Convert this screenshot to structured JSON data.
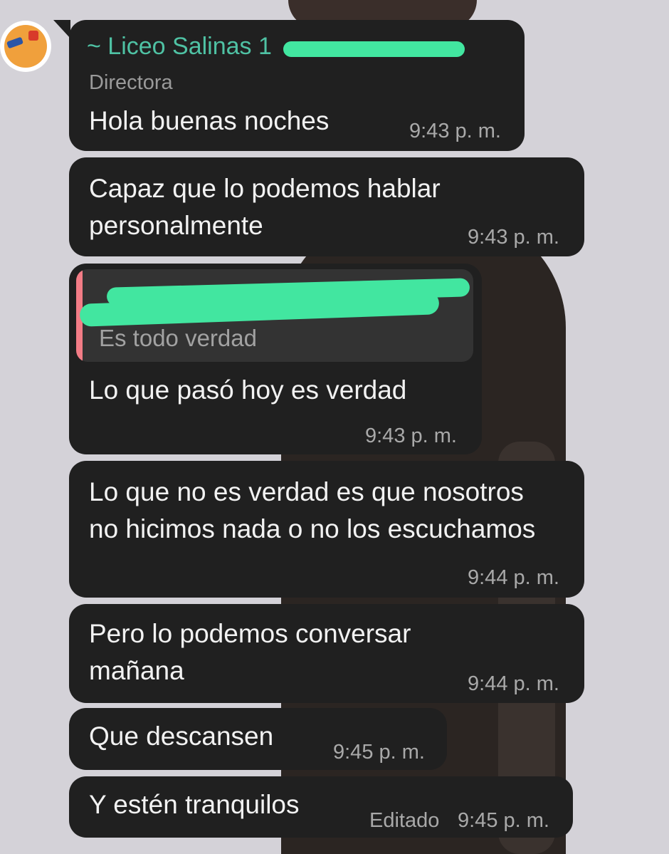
{
  "chat": {
    "group_sender": "~ Liceo Salinas 1",
    "sender_role": "Directora",
    "messages": [
      {
        "text": "Hola buenas noches",
        "time": "9:43 p. m."
      },
      {
        "text": "Capaz que lo podemos hablar personalmente",
        "time": "9:43 p. m."
      },
      {
        "quoted_text": "Es todo verdad",
        "text": "Lo que pasó hoy es verdad",
        "time": "9:43 p. m."
      },
      {
        "text": "Lo que no es verdad es que nosotros no hicimos nada o no los escuchamos",
        "time": "9:44 p. m."
      },
      {
        "text": "Pero lo podemos conversar mañana",
        "time": "9:44 p. m."
      },
      {
        "text": "Que descansen",
        "time": "9:45 p. m."
      },
      {
        "text": "Y estén tranquilos",
        "edited_label": "Editado",
        "time": "9:45 p. m."
      }
    ]
  },
  "colors": {
    "bubble": "#202020",
    "sender_name": "#4fc2a4",
    "quote_bar": "#f27c86",
    "redaction": "#42e6a0"
  }
}
